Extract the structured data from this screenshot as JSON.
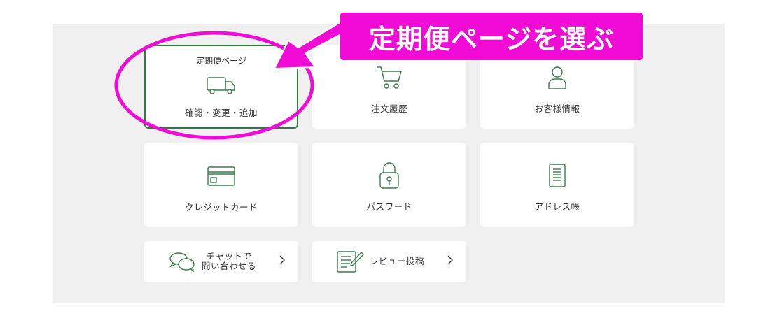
{
  "menu": {
    "subscription": {
      "title": "定期便ページ",
      "label": "確認・変更・追加",
      "icon": "truck-icon"
    },
    "order_history": {
      "label": "注文履歴",
      "icon": "cart-icon"
    },
    "customer_info": {
      "label": "お客様情報",
      "icon": "user-icon"
    },
    "credit_card": {
      "label": "クレジットカード",
      "icon": "credit-card-icon"
    },
    "password": {
      "label": "パスワード",
      "icon": "lock-icon"
    },
    "address_book": {
      "label": "アドレス帳",
      "icon": "notebook-icon"
    },
    "chat": {
      "line1": "チャットで",
      "line2": "問い合わせる",
      "icon": "chat-bubbles-icon"
    },
    "review": {
      "label": "レビュー投稿",
      "icon": "review-pen-icon"
    }
  },
  "annotation": {
    "text": "定期便ページを選ぶ",
    "highlight_color": "#f20bd6"
  },
  "colors": {
    "accent": "#2e7d3e",
    "icon_stroke": "#3a7a4a"
  }
}
